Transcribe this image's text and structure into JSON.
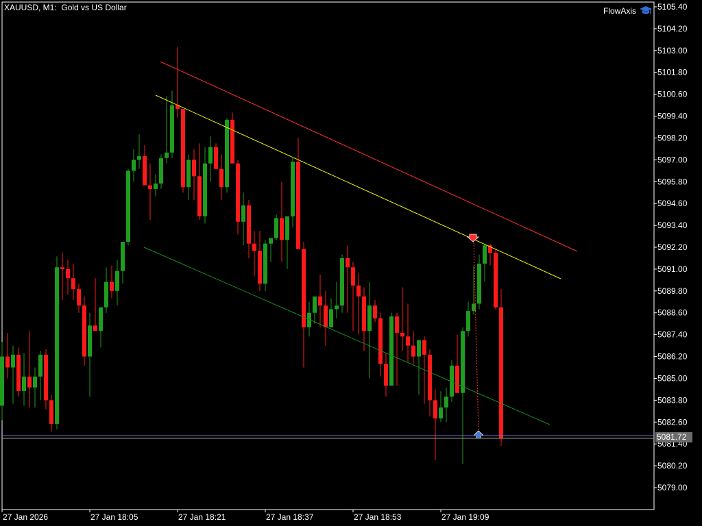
{
  "header": {
    "symbol": "XAUUSD, M1:",
    "description": "Gold vs US Dollar"
  },
  "brand": {
    "name": "FlowAxis",
    "icon": "graduation-cap-icon",
    "icon_color": "#2f6fd6"
  },
  "colors": {
    "background": "#000000",
    "bull": "#1f9d1f",
    "bear": "#ff1a1a",
    "axis": "#ffffff",
    "upper_line": "#ff3030",
    "middle_line": "#f2f200",
    "lower_line": "#1a8c1a",
    "bid_line": "#6f6fd0",
    "price_label_bg": "#6b6b6b"
  },
  "current_price_label": "5081.72",
  "chart_data": {
    "type": "candlestick",
    "symbol": "XAUUSD",
    "timeframe": "M1",
    "title": "XAUUSD, M1:  Gold vs US Dollar",
    "y_ticks": [
      "5105.40",
      "5104.20",
      "5103.00",
      "5101.80",
      "5100.60",
      "5099.40",
      "5098.20",
      "5097.00",
      "5095.80",
      "5094.60",
      "5093.40",
      "5092.20",
      "5091.00",
      "5089.80",
      "5088.60",
      "5087.40",
      "5086.20",
      "5085.00",
      "5083.80",
      "5082.60",
      "5081.40",
      "5080.20",
      "5079.00"
    ],
    "x_ticks": [
      "27 Jan 2026",
      "27 Jan 18:05",
      "27 Jan 18:21",
      "27 Jan 18:37",
      "27 Jan 18:53",
      "27 Jan 19:09"
    ],
    "ylim": [
      5078.2,
      5105.8
    ],
    "grid": false,
    "current_price": 5081.72,
    "candles": [
      [
        5083.5,
        5087.0,
        5082.7,
        5086.2
      ],
      [
        5086.2,
        5087.5,
        5085.0,
        5085.6
      ],
      [
        5085.6,
        5086.8,
        5083.6,
        5086.3
      ],
      [
        5086.3,
        5086.7,
        5084.0,
        5084.3
      ],
      [
        5084.3,
        5086.4,
        5083.5,
        5085.1
      ],
      [
        5085.1,
        5087.6,
        5083.4,
        5084.5
      ],
      [
        5084.5,
        5085.6,
        5083.4,
        5085.1
      ],
      [
        5085.1,
        5086.5,
        5083.8,
        5086.3
      ],
      [
        5086.3,
        5086.6,
        5083.3,
        5083.8
      ],
      [
        5083.8,
        5084.1,
        5082.1,
        5082.5
      ],
      [
        5082.5,
        5091.7,
        5082.2,
        5091.1
      ],
      [
        5091.1,
        5091.9,
        5089.3,
        5091.0
      ],
      [
        5091.0,
        5091.5,
        5089.6,
        5090.5
      ],
      [
        5090.5,
        5091.3,
        5089.3,
        5089.9
      ],
      [
        5089.9,
        5090.2,
        5088.6,
        5089.0
      ],
      [
        5089.0,
        5089.5,
        5085.7,
        5086.2
      ],
      [
        5086.2,
        5088.6,
        5084.0,
        5087.9
      ],
      [
        5087.9,
        5090.5,
        5087.6,
        5087.6
      ],
      [
        5087.6,
        5088.2,
        5086.7,
        5088.9
      ],
      [
        5088.9,
        5091.1,
        5088.6,
        5090.3
      ],
      [
        5090.3,
        5091.2,
        5089.4,
        5089.8
      ],
      [
        5089.8,
        5091.5,
        5089.0,
        5090.9
      ],
      [
        5090.9,
        5092.5,
        5090.2,
        5092.5
      ],
      [
        5092.5,
        5096.5,
        5092.3,
        5096.4
      ],
      [
        5096.4,
        5097.6,
        5095.8,
        5097.0
      ],
      [
        5097.0,
        5098.4,
        5096.5,
        5097.2
      ],
      [
        5097.2,
        5097.8,
        5095.7,
        5095.6
      ],
      [
        5095.6,
        5096.8,
        5093.7,
        5095.4
      ],
      [
        5095.4,
        5096.2,
        5095.0,
        5095.7
      ],
      [
        5095.7,
        5097.3,
        5095.4,
        5097.1
      ],
      [
        5097.1,
        5100.5,
        5096.8,
        5097.4
      ],
      [
        5097.4,
        5100.8,
        5097.1,
        5100.0
      ],
      [
        5100.0,
        5103.2,
        5099.3,
        5099.8
      ],
      [
        5099.8,
        5099.8,
        5095.2,
        5095.5
      ],
      [
        5095.5,
        5097.3,
        5094.8,
        5097.0
      ],
      [
        5097.0,
        5097.6,
        5094.8,
        5096.1
      ],
      [
        5096.1,
        5097.9,
        5093.7,
        5093.9
      ],
      [
        5093.9,
        5097.7,
        5093.5,
        5096.8
      ],
      [
        5096.8,
        5098.3,
        5095.8,
        5097.7
      ],
      [
        5097.7,
        5097.9,
        5096.8,
        5096.5
      ],
      [
        5096.5,
        5097.3,
        5094.8,
        5095.5
      ],
      [
        5095.5,
        5099.3,
        5095.2,
        5099.2
      ],
      [
        5099.2,
        5099.6,
        5096.8,
        5096.8
      ],
      [
        5096.8,
        5097.0,
        5092.9,
        5093.6
      ],
      [
        5093.6,
        5095.2,
        5092.3,
        5094.5
      ],
      [
        5094.5,
        5094.8,
        5091.6,
        5092.4
      ],
      [
        5092.4,
        5093.1,
        5090.6,
        5092.0
      ],
      [
        5092.0,
        5093.1,
        5089.8,
        5090.2
      ],
      [
        5090.2,
        5092.6,
        5089.8,
        5092.4
      ],
      [
        5092.4,
        5092.6,
        5091.4,
        5092.7
      ],
      [
        5092.7,
        5094.0,
        5092.6,
        5093.8
      ],
      [
        5093.8,
        5095.8,
        5091.4,
        5092.6
      ],
      [
        5092.6,
        5093.3,
        5091.0,
        5093.9
      ],
      [
        5093.9,
        5097.1,
        5093.3,
        5096.9
      ],
      [
        5096.9,
        5098.2,
        5092.4,
        5092.1
      ],
      [
        5092.1,
        5092.5,
        5085.6,
        5087.8
      ],
      [
        5087.8,
        5089.2,
        5087.3,
        5088.6
      ],
      [
        5088.6,
        5089.3,
        5088.0,
        5089.5
      ],
      [
        5089.5,
        5090.7,
        5087.8,
        5089.0
      ],
      [
        5089.0,
        5089.8,
        5086.8,
        5087.8
      ],
      [
        5087.8,
        5089.4,
        5087.8,
        5088.8
      ],
      [
        5088.8,
        5090.3,
        5088.3,
        5089.0
      ],
      [
        5089.0,
        5091.8,
        5088.6,
        5091.6
      ],
      [
        5091.6,
        5092.3,
        5088.6,
        5091.1
      ],
      [
        5091.1,
        5091.4,
        5087.6,
        5090.1
      ],
      [
        5090.1,
        5090.8,
        5087.4,
        5089.5
      ],
      [
        5089.5,
        5090.0,
        5086.5,
        5087.6
      ],
      [
        5087.6,
        5090.3,
        5085.0,
        5089.0
      ],
      [
        5089.0,
        5089.3,
        5088.1,
        5088.3
      ],
      [
        5088.3,
        5088.6,
        5085.1,
        5085.8
      ],
      [
        5085.8,
        5086.4,
        5084.0,
        5084.6
      ],
      [
        5084.6,
        5088.6,
        5084.6,
        5088.4
      ],
      [
        5088.4,
        5088.6,
        5084.6,
        5087.5
      ],
      [
        5087.5,
        5090.0,
        5086.5,
        5087.3
      ],
      [
        5087.3,
        5089.1,
        5085.9,
        5086.8
      ],
      [
        5086.8,
        5087.6,
        5085.8,
        5086.2
      ],
      [
        5086.2,
        5087.1,
        5084.1,
        5087.1
      ],
      [
        5087.1,
        5087.3,
        5083.6,
        5086.3
      ],
      [
        5086.3,
        5086.6,
        5082.9,
        5083.8
      ],
      [
        5083.8,
        5084.4,
        5080.5,
        5082.8
      ],
      [
        5082.8,
        5084.3,
        5082.6,
        5083.4
      ],
      [
        5083.4,
        5084.5,
        5082.6,
        5084.0
      ],
      [
        5084.0,
        5086.0,
        5083.7,
        5085.7
      ],
      [
        5085.7,
        5087.4,
        5084.2,
        5084.2
      ],
      [
        5084.2,
        5087.8,
        5080.3,
        5087.6
      ],
      [
        5087.6,
        5089.2,
        5087.3,
        5088.7
      ],
      [
        5088.7,
        5091.2,
        5088.5,
        5089.1
      ],
      [
        5089.1,
        5091.8,
        5088.8,
        5091.3
      ],
      [
        5091.3,
        5092.4,
        5090.3,
        5092.3
      ],
      [
        5092.3,
        5092.4,
        5091.2,
        5091.9
      ],
      [
        5091.9,
        5092.1,
        5088.8,
        5088.9
      ],
      [
        5088.9,
        5089.9,
        5081.3,
        5081.7
      ]
    ],
    "trend_lines": [
      {
        "color": "upper_line",
        "from": [
          234,
          90
        ],
        "to": [
          842,
          367
        ]
      },
      {
        "color": "middle_line",
        "from": [
          227,
          139
        ],
        "to": [
          818,
          407
        ]
      },
      {
        "color": "lower_line",
        "from": [
          210,
          361
        ],
        "to": [
          802,
          620
        ]
      }
    ]
  }
}
